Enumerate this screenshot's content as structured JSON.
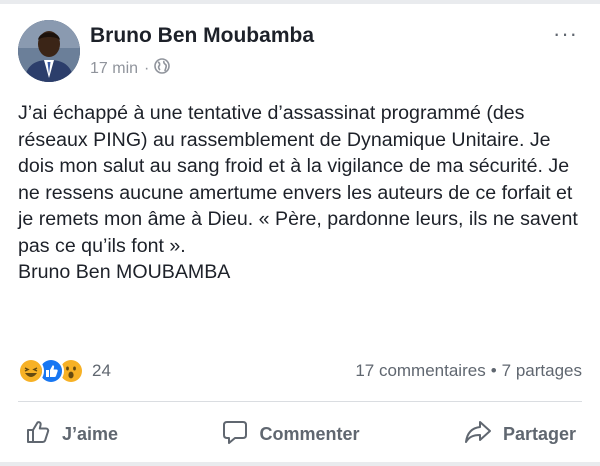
{
  "post": {
    "author": "Bruno Ben Moubamba",
    "time": "17 min",
    "separator": "·",
    "privacy_icon": "globe-icon",
    "more_label": "···",
    "text": "J’ai échappé à une tentative d’assassinat programmé (des réseaux PING) au rassemblement de Dynamique Unitaire. Je dois mon salut au sang froid et à la vigilance de ma sécurité. Je ne ressens aucune amertume envers les auteurs de ce forfait et je remets mon âme à Dieu. « Père, pardonne leurs, ils ne savent pas ce qu’ils font ».",
    "signature": "Bruno Ben MOUBAMBA"
  },
  "stats": {
    "reactions": [
      "haha-icon",
      "like-icon",
      "wow-icon"
    ],
    "reaction_count": "24",
    "comments": "17 commentaires",
    "dot": "•",
    "shares": "7 partages"
  },
  "actions": {
    "like": "J’aime",
    "comment": "Commenter",
    "share": "Partager"
  },
  "colors": {
    "like_blue": "#1877f2",
    "reaction_yellow": "#f7b125",
    "text": "#1d2129",
    "secondary": "#606770"
  }
}
